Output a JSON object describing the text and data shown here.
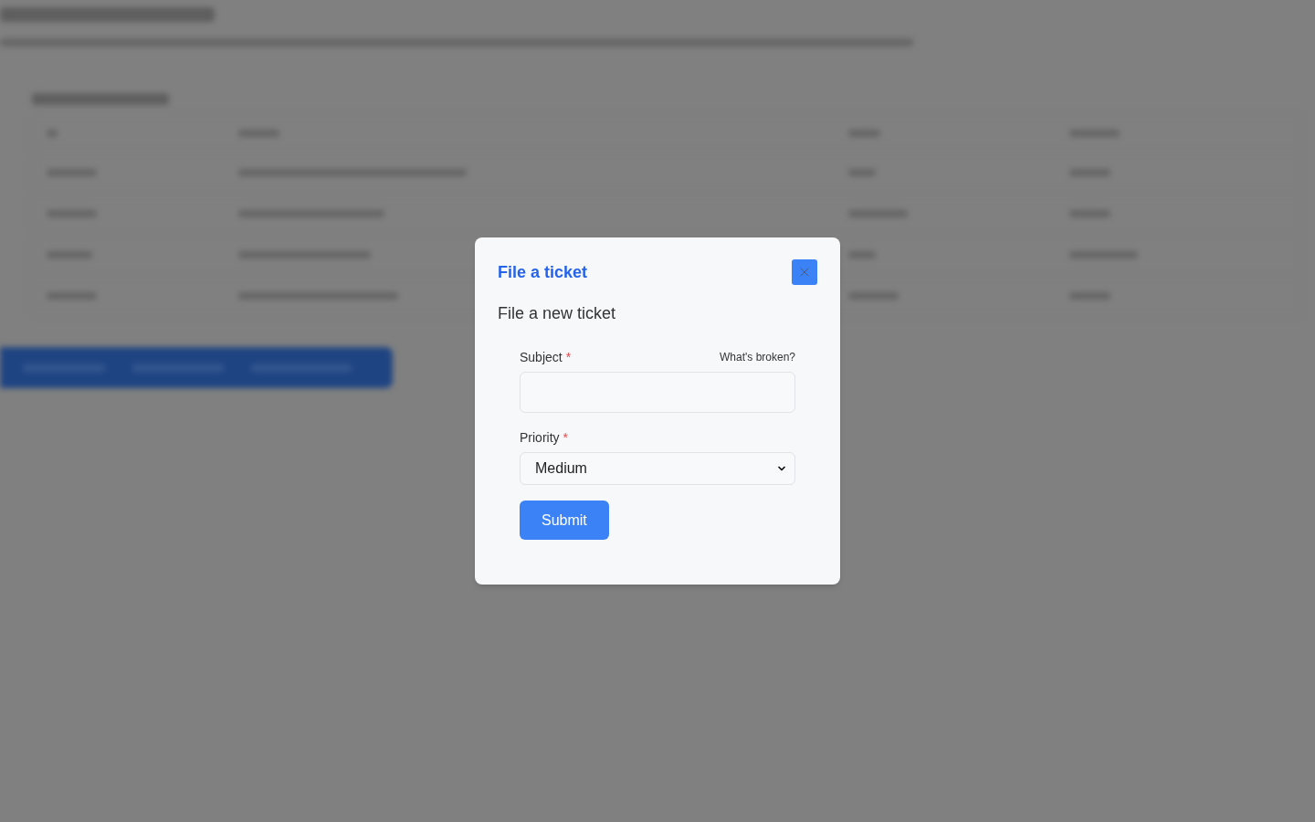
{
  "dialog": {
    "title": "File a ticket",
    "subtitle": "File a new ticket",
    "fields": [
      {
        "kind": "text",
        "label": "Subject",
        "required_mark": "*",
        "hint": "What's broken?"
      },
      {
        "kind": "select",
        "label": "Priority",
        "required_mark": "*",
        "value": "Medium"
      }
    ],
    "submit_label": "Submit"
  }
}
